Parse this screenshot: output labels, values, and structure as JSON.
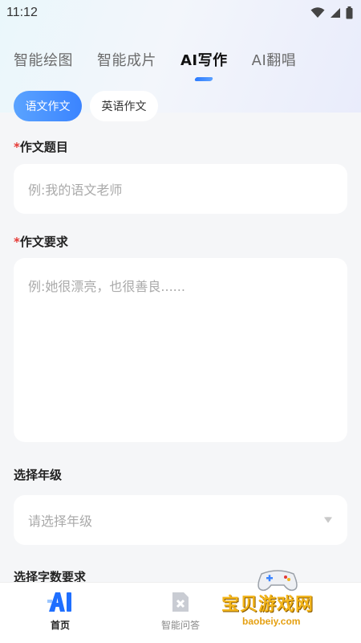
{
  "status_bar": {
    "time": "11:12",
    "icons": [
      "wifi-icon",
      "signal-icon",
      "battery-icon"
    ]
  },
  "top_tabs": [
    {
      "label": "智能绘图",
      "active": false
    },
    {
      "label": "智能成片",
      "active": false
    },
    {
      "label": "AI写作",
      "active": true
    },
    {
      "label": "AI翻唱",
      "active": false
    }
  ],
  "sub_tabs": [
    {
      "label": "语文作文",
      "active": true
    },
    {
      "label": "英语作文",
      "active": false
    }
  ],
  "form": {
    "title_label": "作文题目",
    "title_placeholder": "例:我的语文老师",
    "requirement_label": "作文要求",
    "requirement_placeholder": "例:她很漂亮，也很善良......",
    "grade_label": "选择年级",
    "grade_placeholder": "请选择年级",
    "wordcount_label": "选择字数要求",
    "required_mark": "*"
  },
  "bottom_nav": [
    {
      "label": "首页",
      "icon": "ai-icon",
      "active": true
    },
    {
      "label": "智能问答",
      "icon": "chat-icon",
      "active": false
    }
  ],
  "watermark": {
    "text": "宝贝游戏网",
    "url": "baobeiy.com"
  },
  "colors": {
    "accent": "#3b84ff",
    "required": "#e53935",
    "watermark": "#f3b51a"
  }
}
